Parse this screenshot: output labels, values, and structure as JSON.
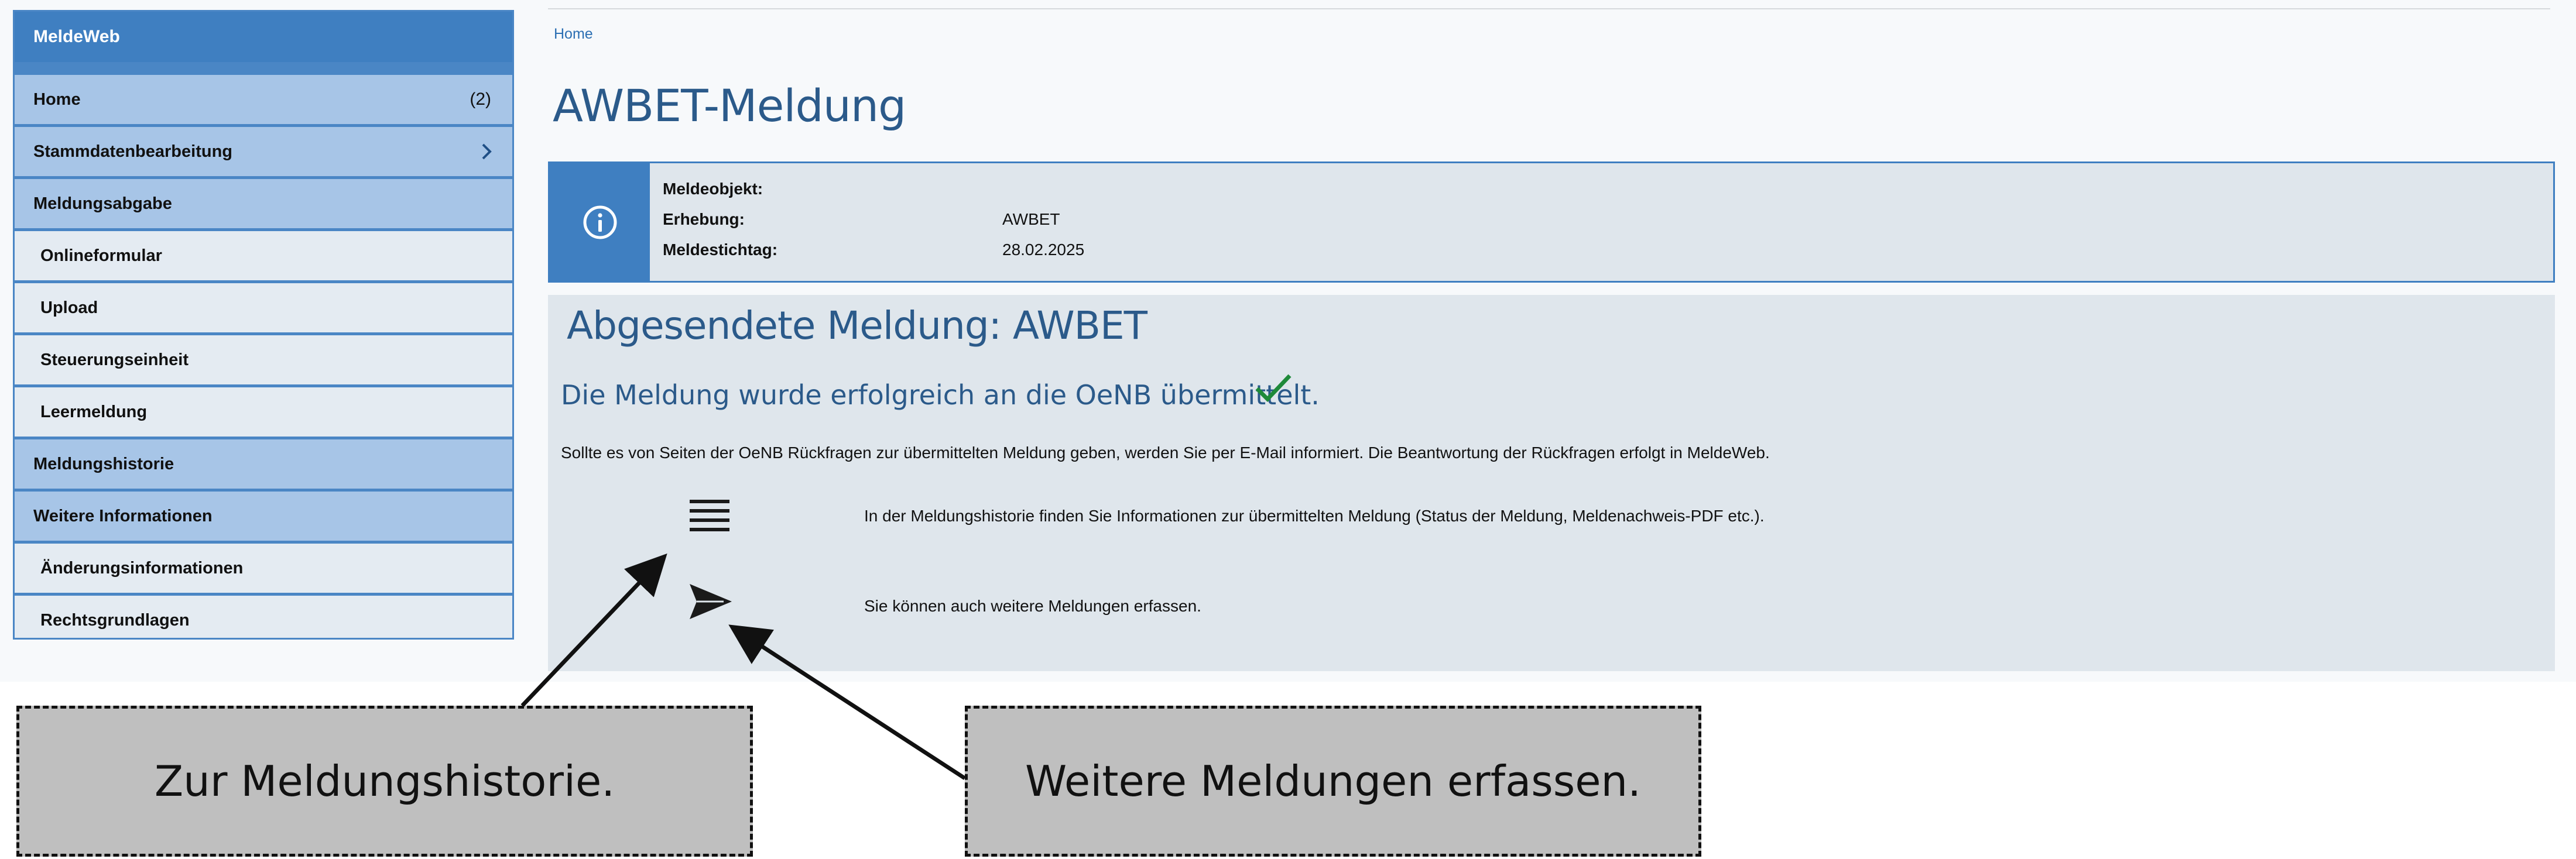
{
  "sidebar": {
    "app_name": "MeldeWeb",
    "items": [
      {
        "label": "Home",
        "count": "(2)"
      },
      {
        "label": "Stammdatenbearbeitung"
      },
      {
        "label": "Meldungsabgabe"
      },
      {
        "label": "Onlineformular"
      },
      {
        "label": "Upload"
      },
      {
        "label": "Steuerungseinheit"
      },
      {
        "label": "Leermeldung"
      },
      {
        "label": "Meldungshistorie"
      },
      {
        "label": "Weitere Informationen"
      },
      {
        "label": "Änderungsinformationen"
      },
      {
        "label": "Rechtsgrundlagen"
      }
    ]
  },
  "breadcrumb": {
    "home": "Home"
  },
  "page": {
    "title": "AWBET-Meldung"
  },
  "info": {
    "icon": "info-circle-icon",
    "rows": [
      {
        "label": "Meldeobjekt:",
        "value": ""
      },
      {
        "label": "Erhebung:",
        "value": "AWBET"
      },
      {
        "label": "Meldestichtag:",
        "value": "28.02.2025"
      }
    ]
  },
  "result": {
    "title": "Abgesendete Meldung: AWBET",
    "success": "Die Meldung wurde erfolgreich an die OeNB übermittelt.",
    "notice": "Sollte es von Seiten der OeNB Rückfragen zur übermittelten Meldung geben, werden Sie per E-Mail informiert. Die Beantwortung der Rückfragen erfolgt in MeldeWeb.",
    "history_text": "In der Meldungshistorie finden Sie Informationen zur übermittelten Meldung (Status der Meldung, Meldenachweis-PDF etc.).",
    "more_text": "Sie können auch weitere Meldungen erfassen."
  },
  "annotations": {
    "history": "Zur Meldungshistorie.",
    "more": "Weitere Meldungen erfassen."
  },
  "colors": {
    "brand": "#3f7fc1",
    "section": "#a7c5e7",
    "subitem": "#e4ebf2",
    "panel": "#dfe6ec",
    "title": "#2b5a8a",
    "success": "#1f8a3a"
  }
}
